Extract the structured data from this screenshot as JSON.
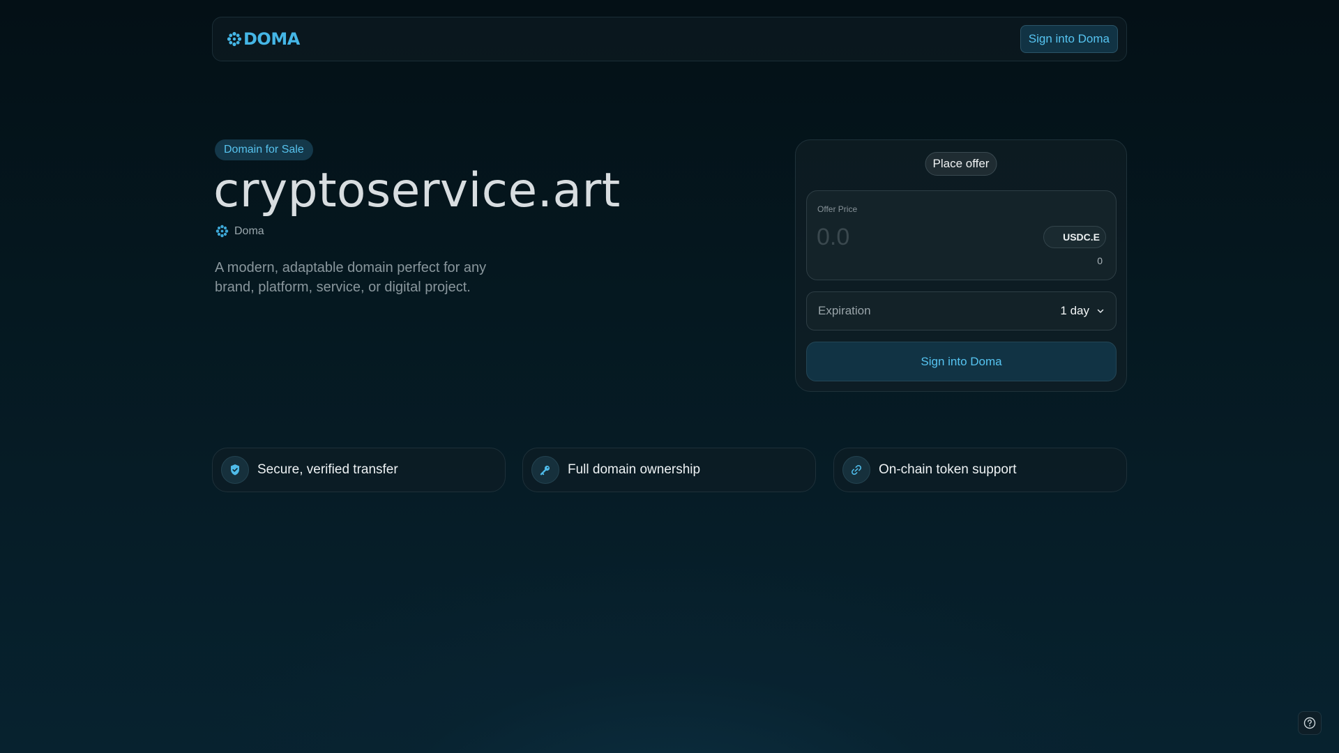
{
  "header": {
    "logo_text": "DOMA",
    "sign_in_label": "Sign into Doma"
  },
  "hero": {
    "badge": "Domain for Sale",
    "domain_name": "cryptoservice.art",
    "registrar": "Doma",
    "description": "A modern, adaptable domain perfect for any brand, platform, service, or digital project."
  },
  "offer": {
    "tab_label": "Place offer",
    "price_label": "Offer Price",
    "price_value": "",
    "price_placeholder": "0.0",
    "currency": "USDC.E",
    "balance": "0",
    "expiration_label": "Expiration",
    "expiration_value": "1 day",
    "cta_label": "Sign into Doma"
  },
  "features": [
    {
      "label": "Secure, verified transfer",
      "icon": "shield-check-icon"
    },
    {
      "label": "Full domain ownership",
      "icon": "key-icon"
    },
    {
      "label": "On-chain token support",
      "icon": "link-icon"
    }
  ],
  "colors": {
    "accent": "#56c4f1",
    "background": "#051820",
    "button_bg": "#113344"
  },
  "help": {
    "icon": "help-icon"
  }
}
